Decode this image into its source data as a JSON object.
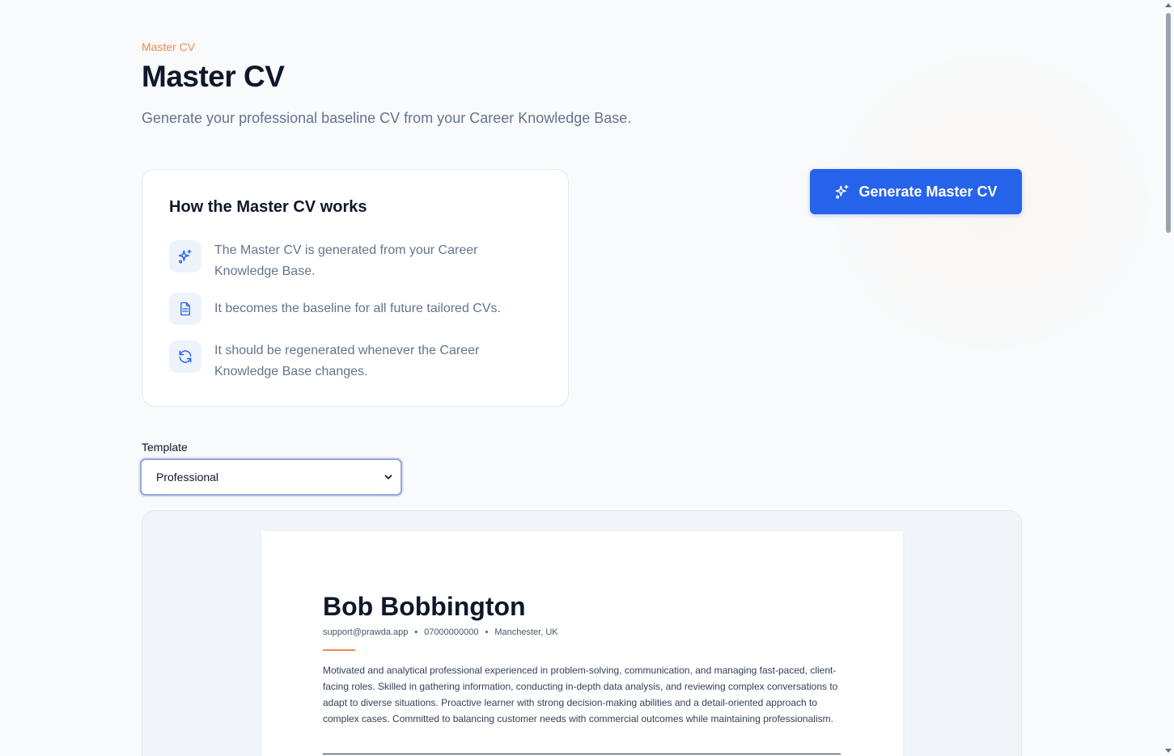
{
  "header": {
    "breadcrumb": "Master CV",
    "title": "Master CV",
    "subtitle": "Generate your professional baseline CV from your Career Knowledge Base."
  },
  "info_card": {
    "title": "How the Master CV works",
    "items": [
      {
        "icon": "sparkles-icon",
        "text": "The Master CV is generated from your Career Knowledge Base."
      },
      {
        "icon": "document-icon",
        "text": "It becomes the baseline for all future tailored CVs."
      },
      {
        "icon": "refresh-icon",
        "text": "It should be regenerated whenever the Career Knowledge Base changes."
      }
    ]
  },
  "generate_button": {
    "label": "Generate Master CV",
    "icon": "sparkles-icon"
  },
  "template": {
    "label": "Template",
    "selected": "Professional"
  },
  "cv_preview": {
    "name": "Bob Bobbington",
    "email": "support@prawda.app",
    "phone": "07000000000",
    "location": "Manchester, UK",
    "separator": "•",
    "summary": "Motivated and analytical professional experienced in problem-solving, communication, and managing fast-paced, client-facing roles. Skilled in gathering information, conducting in-depth data analysis, and reviewing complex conversations to adapt to diverse situations. Proactive learner with strong decision-making abilities and a detail-oriented approach to complex cases. Committed to balancing customer needs with commercial outcomes while maintaining professionalism."
  },
  "colors": {
    "accent_orange": "#f08a4b",
    "primary_blue": "#2563eb",
    "muted_text": "#64748b",
    "icon_bg": "#eef2fb"
  }
}
